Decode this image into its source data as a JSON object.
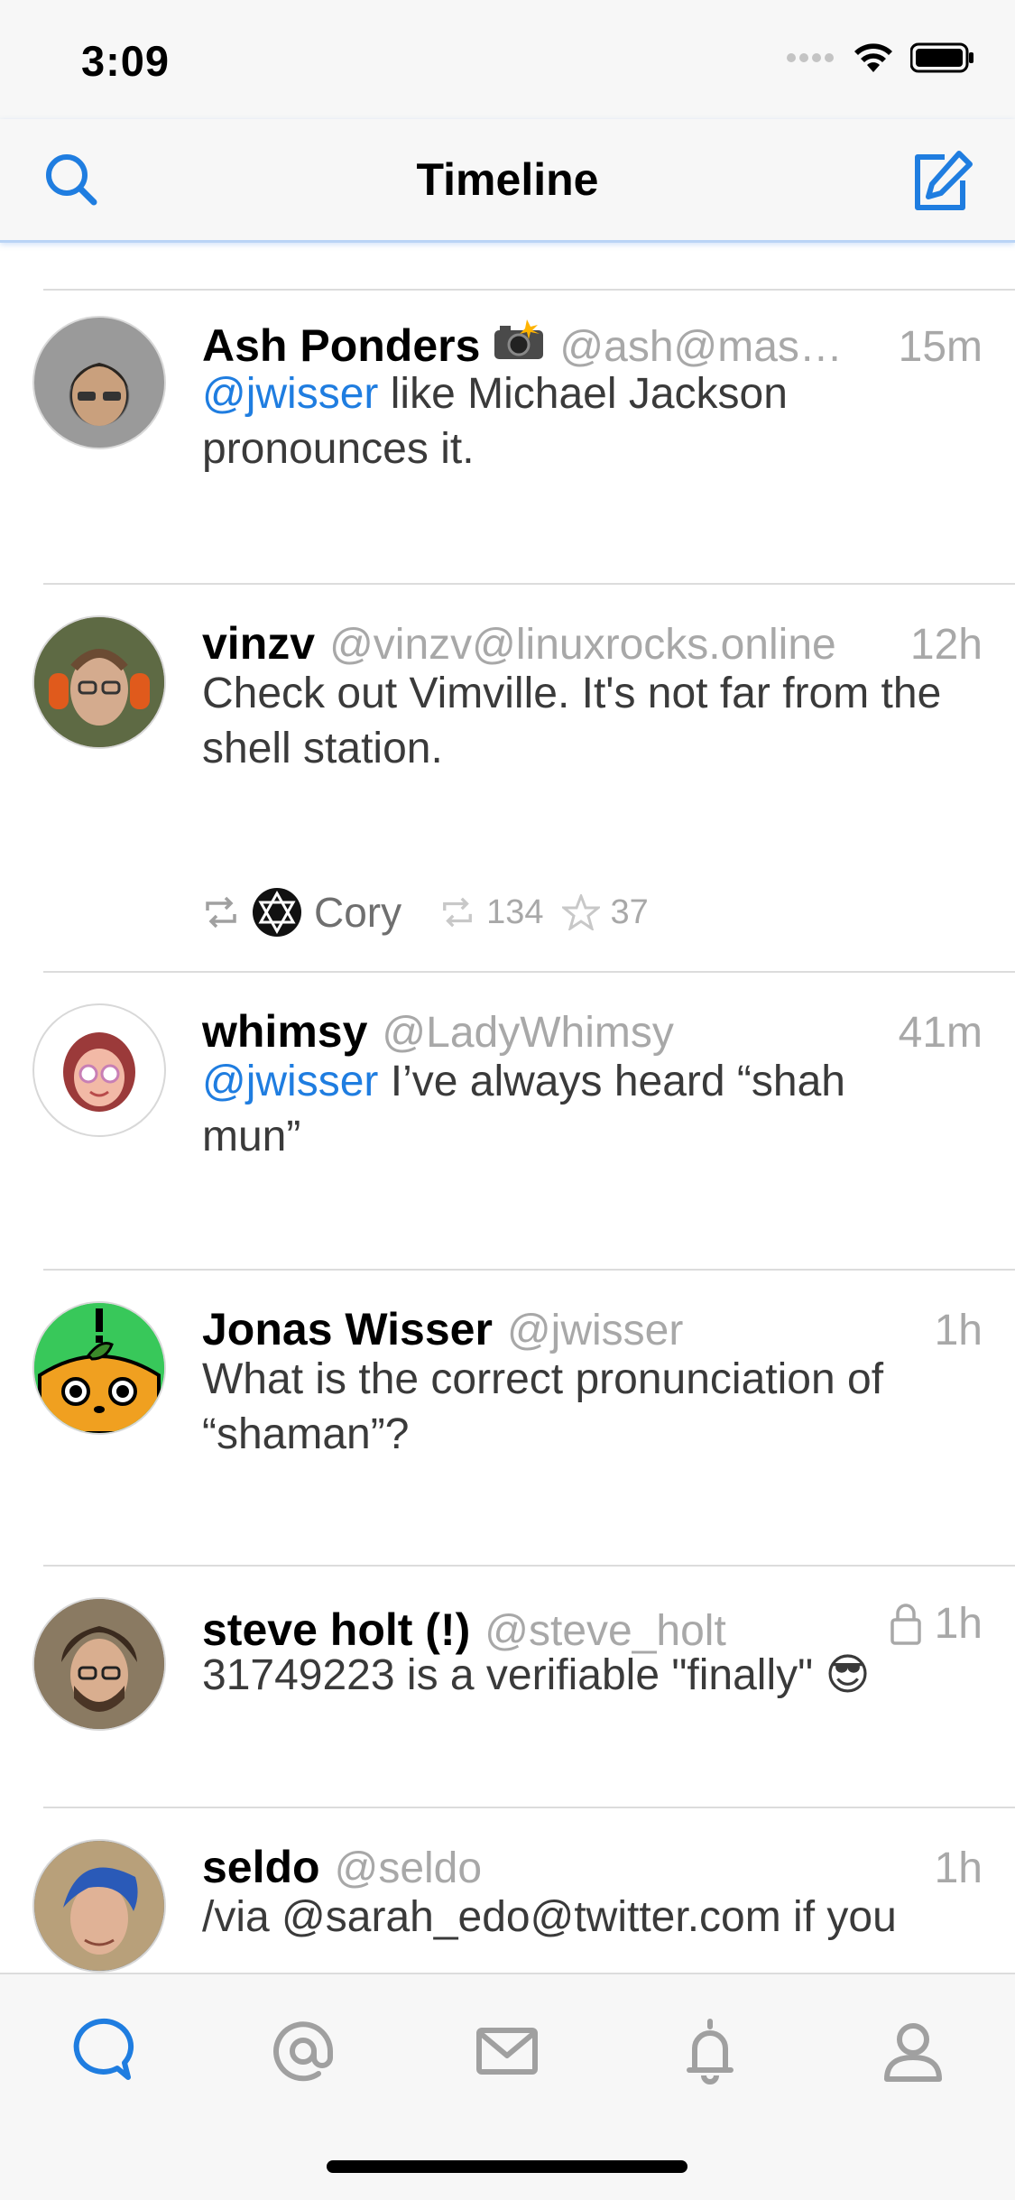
{
  "status_bar": {
    "time": "3:09"
  },
  "nav": {
    "title": "Timeline"
  },
  "posts": [
    {
      "name": "Ash Ponders",
      "handle": "@ash@mas…",
      "time": "15m",
      "mention": "@jwisser",
      "text": " like Michael Jackson pronounces it.",
      "avatar_color": "#8a8a8a"
    },
    {
      "name": "vinzv",
      "handle": "@vinzv@linuxrocks.online",
      "time": "12h",
      "mention": "",
      "text": "Check out Vimville. It's not far from the shell station.",
      "boosted_by": "Cory",
      "boost_count": "134",
      "fav_count": "37",
      "avatar_color": "#7a6a55"
    },
    {
      "name": "whimsy",
      "handle": "@LadyWhimsy",
      "time": "41m",
      "mention": "@jwisser",
      "text": " I’ve always heard “shah mun”",
      "avatar_color": "#ffffff"
    },
    {
      "name": "Jonas Wisser",
      "handle": "@jwisser",
      "time": "1h",
      "mention": "",
      "text": "What is the correct pronunciation of “shaman”?",
      "avatar_color": "#3cc85a"
    },
    {
      "name": "steve holt (!)",
      "handle": "@steve_holt",
      "time": "1h",
      "mention": "",
      "text": "31749223 is a verifiable \"finally\" 😎",
      "avatar_color": "#6b5a4a"
    },
    {
      "name": "seldo",
      "handle": "@seldo",
      "time": "1h",
      "mention": "",
      "text": "/via @sarah_edo@twitter.com if you",
      "avatar_color": "#3a6fb5"
    }
  ],
  "colors": {
    "accent": "#1f7de0",
    "secondary_text": "#a8a8a8"
  },
  "tabs": [
    "timeline-icon",
    "mentions-icon",
    "messages-icon",
    "notifications-icon",
    "profile-icon"
  ]
}
